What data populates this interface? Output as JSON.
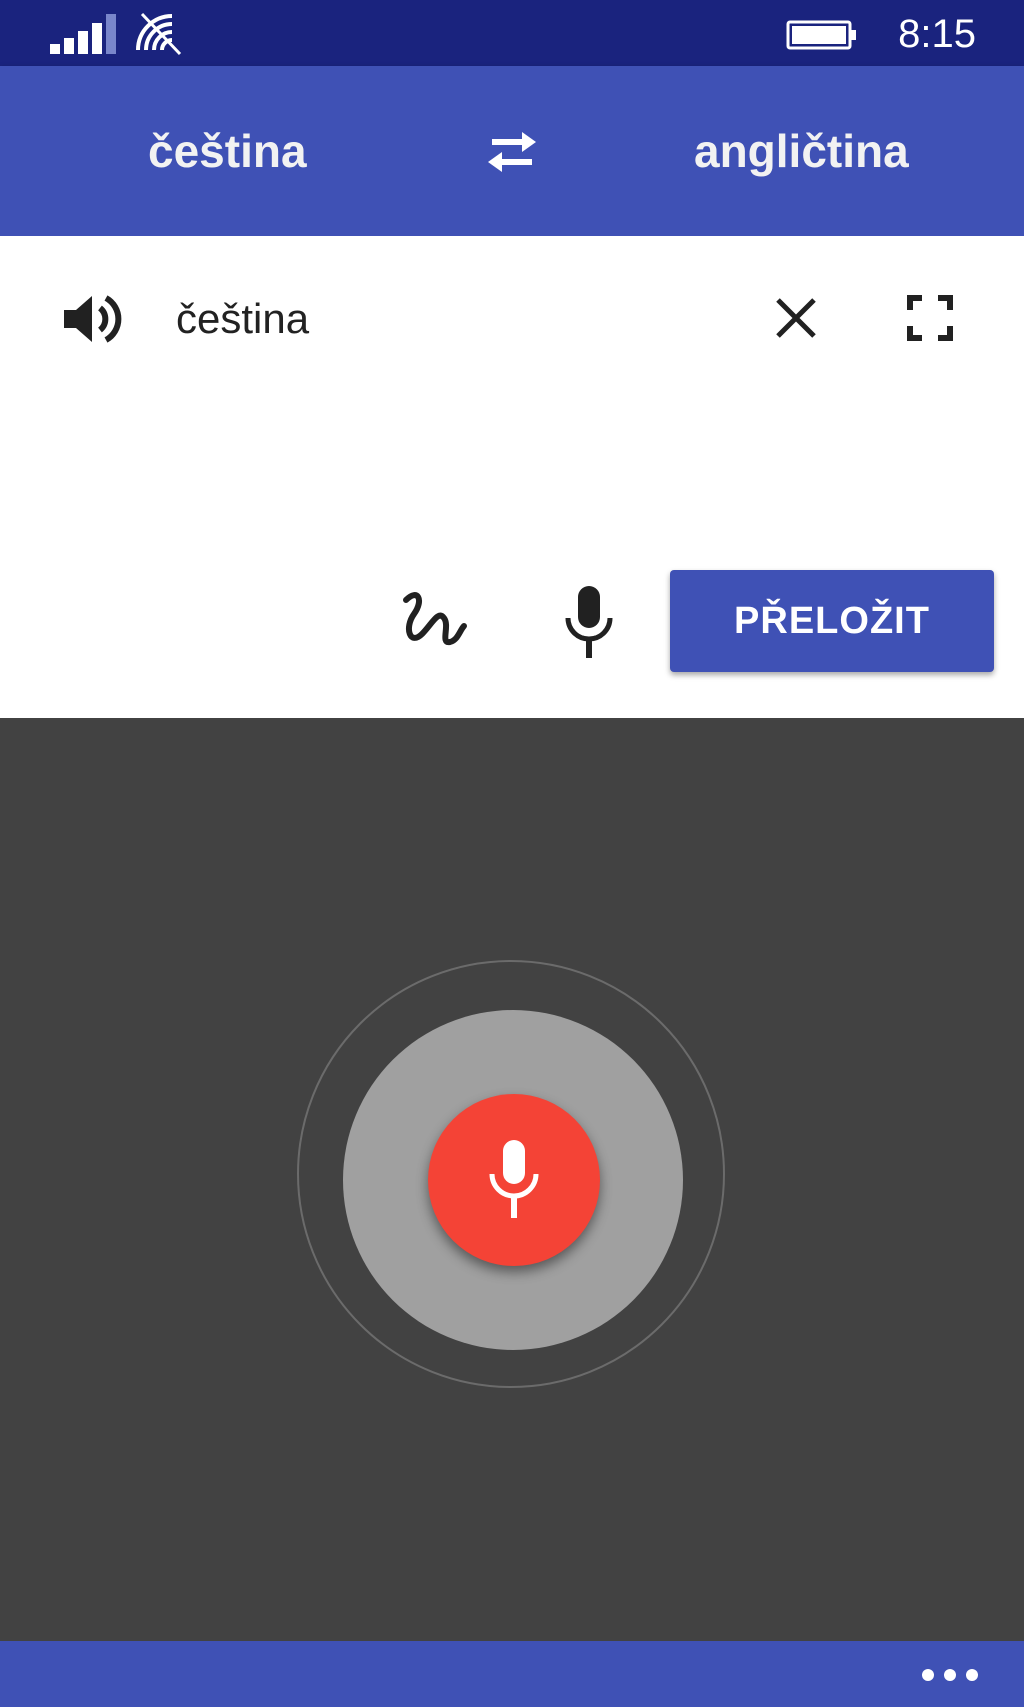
{
  "status_bar": {
    "time": "8:15",
    "icons": [
      "signal-icon",
      "wifi-icon",
      "battery-icon"
    ]
  },
  "app_bar": {
    "source_language": "čeština",
    "target_language": "angličtina",
    "swap_icon": "swap-icon"
  },
  "input_panel": {
    "text": "čeština",
    "speaker_icon": "speaker-icon",
    "clear_icon": "close-icon",
    "fullscreen_icon": "fullscreen-icon",
    "handwriting_icon": "handwriting-icon",
    "mic_icon": "microphone-icon",
    "translate_label": "PŘELOŽIT"
  },
  "voice_area": {
    "mic_icon": "microphone-icon"
  },
  "bottom_bar": {
    "more_icon": "more-icon"
  },
  "colors": {
    "status_bar": "#1a237e",
    "primary": "#3f51b5",
    "voice_background": "#424242",
    "mic_fab": "#f44336",
    "ring": "#a0a0a0"
  }
}
